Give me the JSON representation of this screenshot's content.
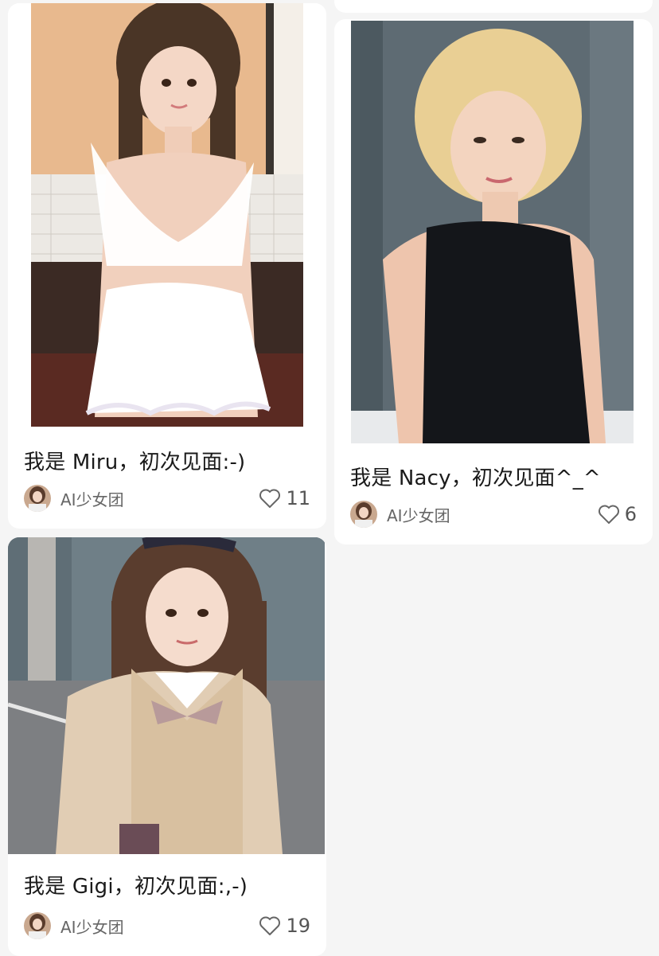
{
  "feed": {
    "cards": [
      {
        "title": "我是 Miru，初次见面:-)",
        "author": "AI少女团",
        "likes": "11",
        "image": "photo-girl-white-ruffle-outfit",
        "avatar": "avatar-ai-girl-group"
      },
      {
        "title": "我是 Nacy，初次见面^_^",
        "author": "AI少女团",
        "likes": "6",
        "image": "photo-blonde-girl-black-top",
        "avatar": "avatar-ai-girl-group"
      },
      {
        "title": "我是 Gigi，初次见面:,-)",
        "author": "AI少女团",
        "likes": "19",
        "image": "photo-girl-school-blazer",
        "avatar": "avatar-ai-girl-group"
      }
    ]
  },
  "colors": {
    "background": "#f5f5f5",
    "card": "#ffffff",
    "title": "#1a1a1a",
    "meta": "#666666"
  }
}
